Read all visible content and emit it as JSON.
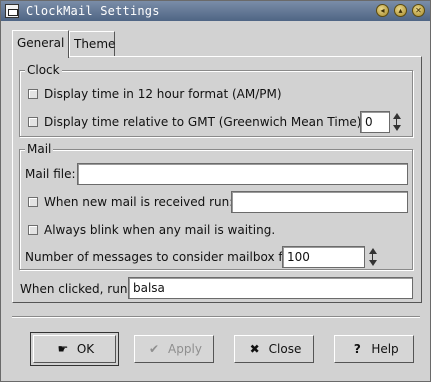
{
  "window": {
    "title": "ClockMail Settings",
    "controls": [
      "minimize-icon",
      "maximize-icon",
      "close-icon"
    ],
    "control_glyphs": [
      "◂",
      "▴",
      "✕"
    ]
  },
  "tabs": [
    {
      "label": "General",
      "active": true
    },
    {
      "label": "Theme",
      "active": false
    }
  ],
  "clock": {
    "group_label": "Clock",
    "twelve_hour_label": "Display time in 12 hour format (AM/PM)",
    "gmt_label": "Display time relative to GMT (Greenwich Mean Time):",
    "gmt_offset": "0"
  },
  "mail": {
    "group_label": "Mail",
    "mail_file_label": "Mail file:",
    "mail_file_value": "",
    "new_mail_label": "When new mail is received run:",
    "new_mail_value": "",
    "blink_label": "Always blink when any mail is waiting.",
    "full_label": "Number of messages to consider mailbox full:",
    "full_value": "100"
  },
  "on_click": {
    "label": "When clicked, run:",
    "value": "balsa"
  },
  "buttons": {
    "ok": "OK",
    "apply": "Apply",
    "close": "Close",
    "help": "Help"
  },
  "colors": {
    "titlebar": "#5b6f8c",
    "background": "#d2d2d2"
  }
}
